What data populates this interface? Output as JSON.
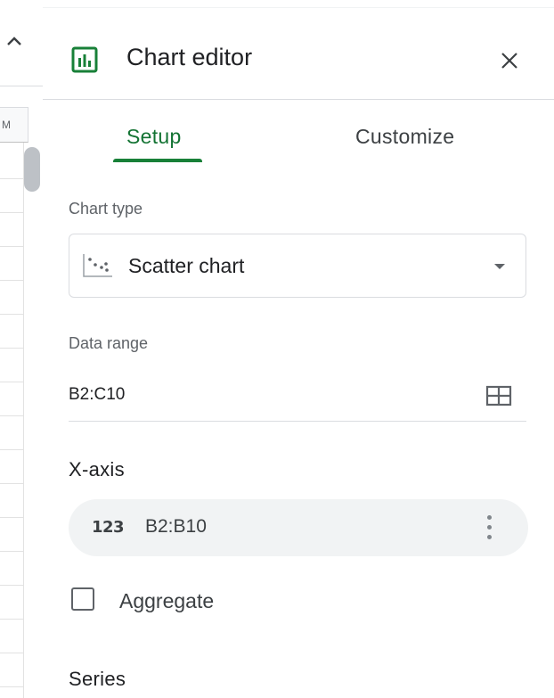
{
  "strip": {
    "column_letter": "M"
  },
  "editor": {
    "title": "Chart editor",
    "tabs": [
      {
        "label": "Setup",
        "active": true
      },
      {
        "label": "Customize",
        "active": false
      }
    ],
    "chart_type": {
      "label": "Chart type",
      "value": "Scatter chart"
    },
    "data_range": {
      "label": "Data range",
      "value": "B2:C10"
    },
    "x_axis": {
      "heading": "X-axis",
      "type_icon_text": "123",
      "value": "B2:B10"
    },
    "aggregate": {
      "label": "Aggregate",
      "checked": false
    },
    "series": {
      "heading": "Series"
    }
  },
  "icons": {
    "collapse": "chevron-up-icon",
    "chart": "bar-chart-icon",
    "close": "close-icon",
    "scatter": "scatter-chart-icon",
    "dropdown": "caret-down-icon",
    "select_range": "grid-icon",
    "number_type": "numeric-type-icon",
    "more": "more-vert-icon"
  },
  "colors": {
    "accent_green": "#188038",
    "chip_background": "#f1f3f4",
    "divider": "#dadce0"
  }
}
